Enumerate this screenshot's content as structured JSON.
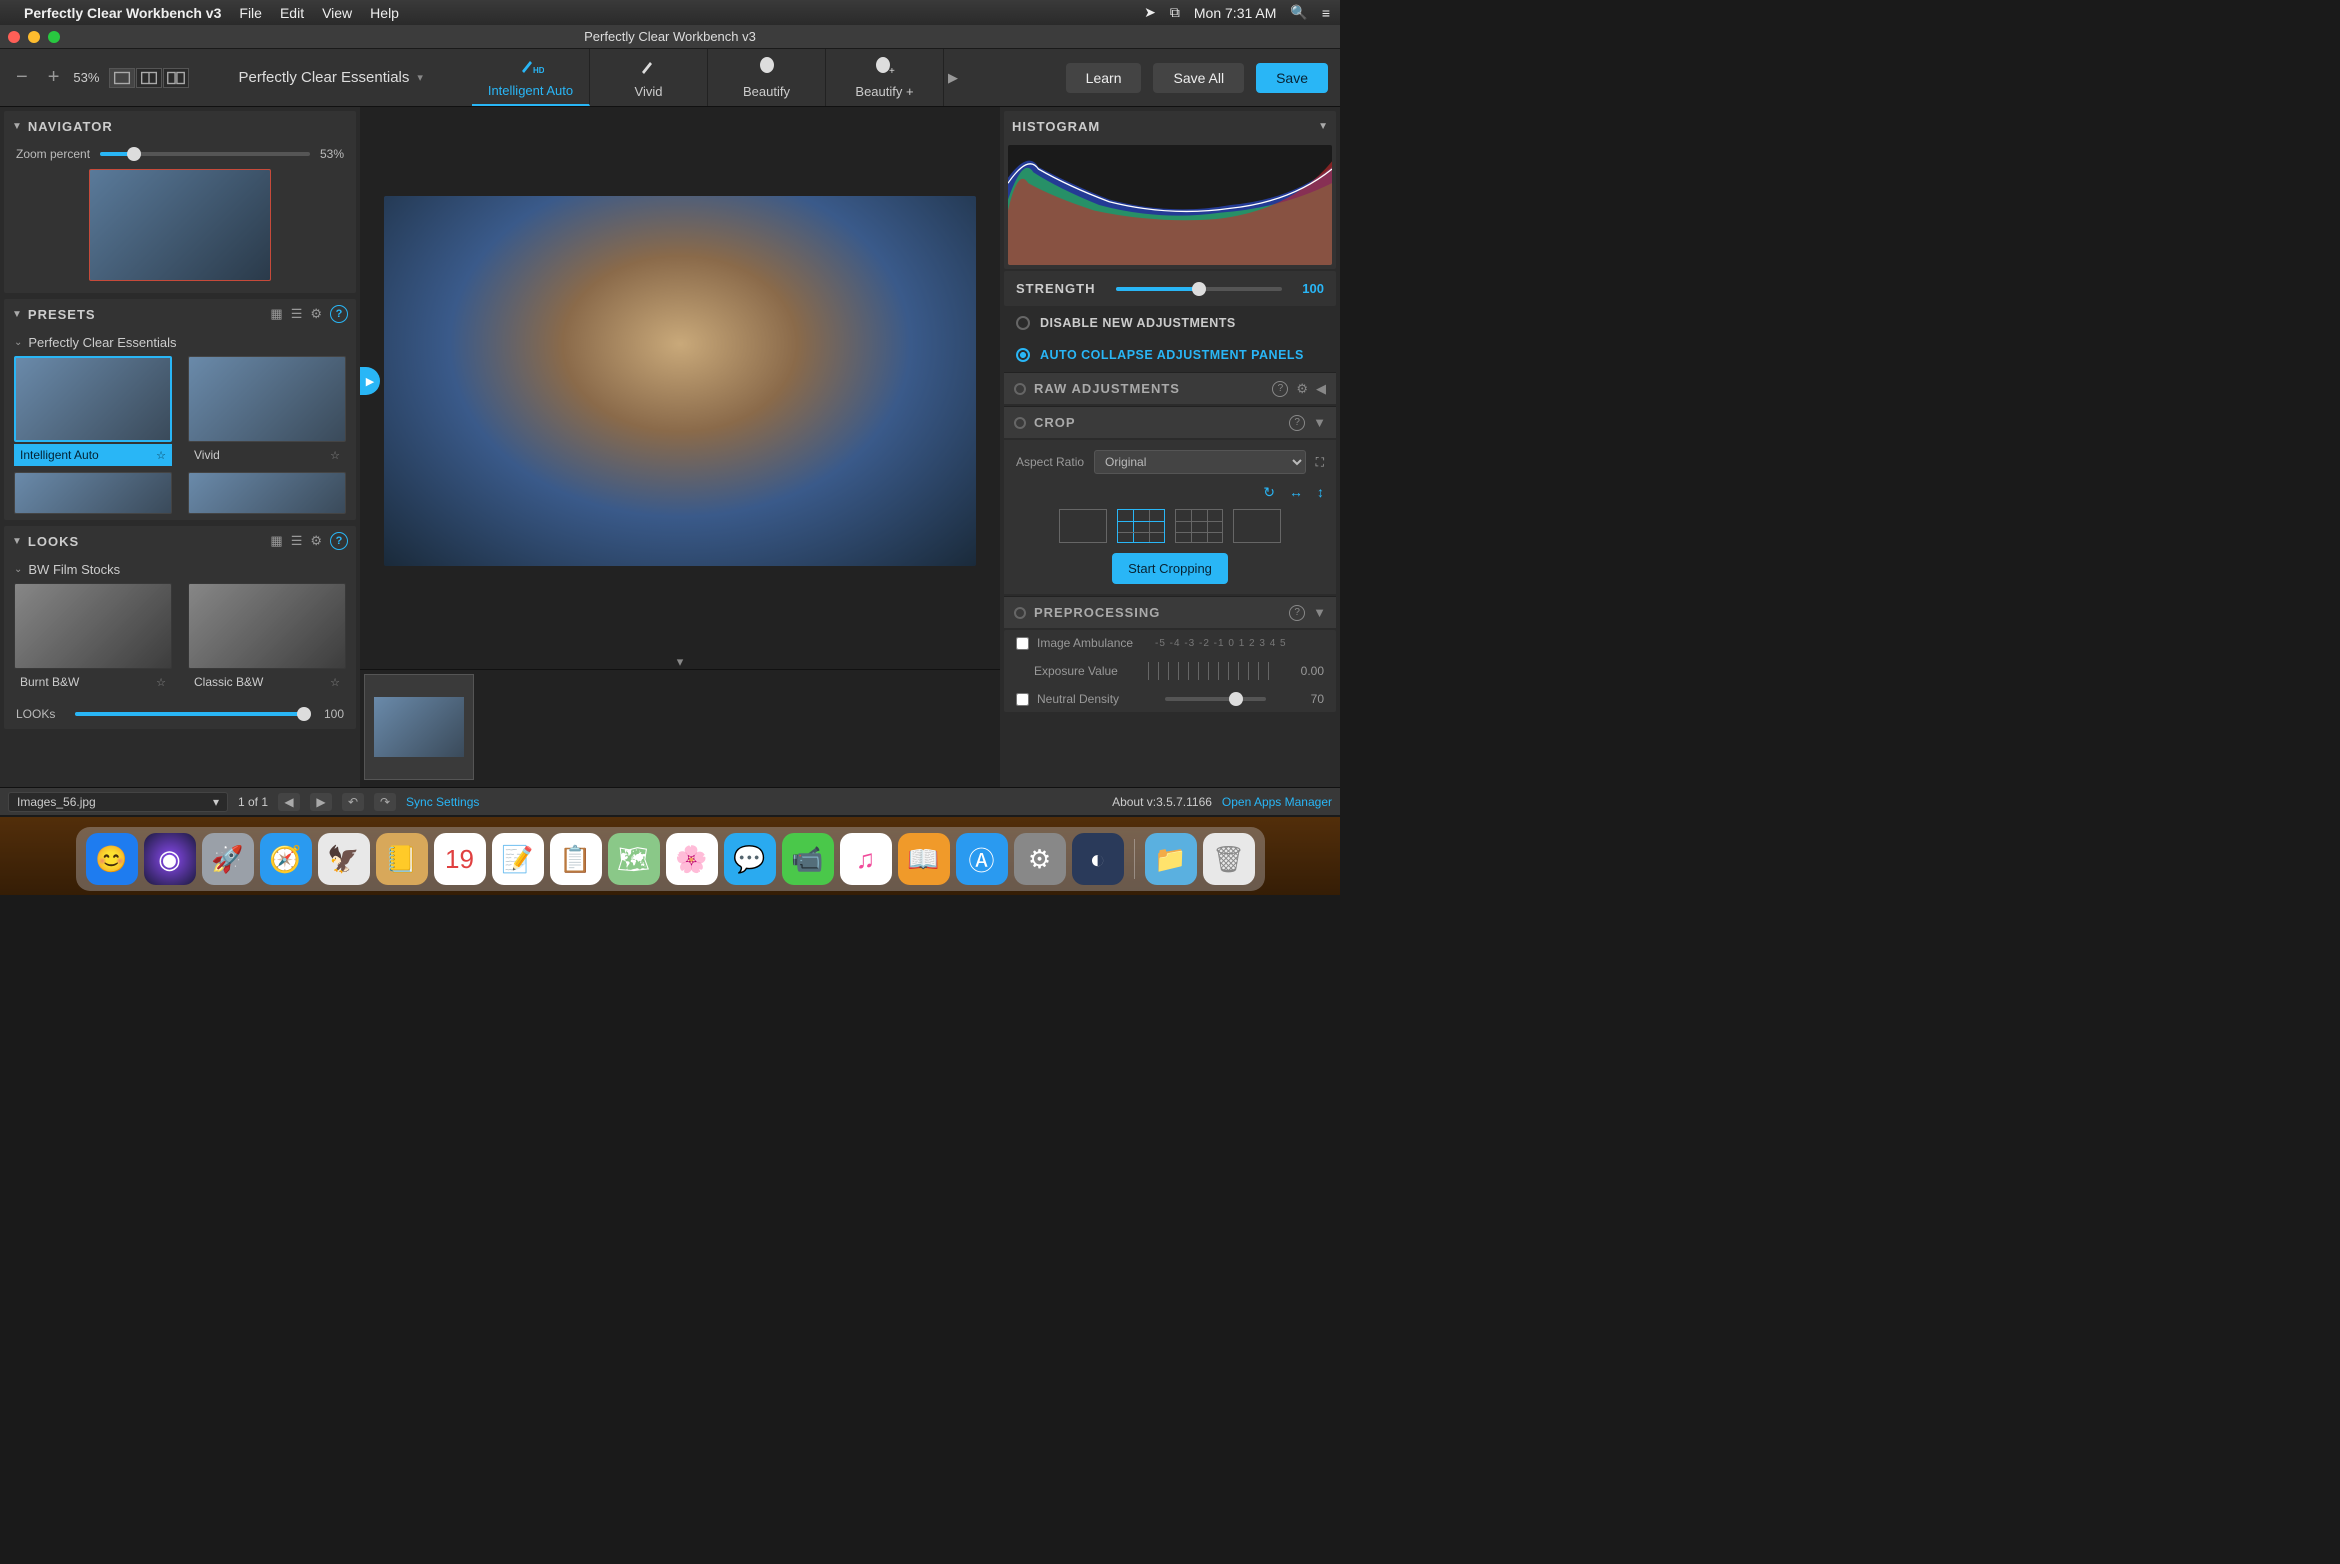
{
  "menubar": {
    "app_name": "Perfectly Clear Workbench v3",
    "items": [
      "File",
      "Edit",
      "View",
      "Help"
    ],
    "clock": "Mon 7:31 AM"
  },
  "window": {
    "title": "Perfectly Clear Workbench v3"
  },
  "toolbar": {
    "zoom_minus": "−",
    "zoom_plus": "+",
    "zoom_value": "53%",
    "preset_name": "Perfectly Clear Essentials",
    "tabs": [
      {
        "label": "Intelligent Auto",
        "badge": "HD",
        "active": true
      },
      {
        "label": "Vivid",
        "active": false
      },
      {
        "label": "Beautify",
        "active": false
      },
      {
        "label": "Beautify +",
        "active": false
      }
    ],
    "learn": "Learn",
    "save_all": "Save All",
    "save": "Save"
  },
  "navigator": {
    "title": "NAVIGATOR",
    "zoom_label": "Zoom percent",
    "zoom_value": "53%",
    "zoom_pct": 16
  },
  "presets": {
    "title": "PRESETS",
    "group": "Perfectly Clear Essentials",
    "items": [
      {
        "label": "Intelligent Auto",
        "selected": true
      },
      {
        "label": "Vivid",
        "selected": false
      }
    ]
  },
  "looks": {
    "title": "LOOKS",
    "group": "BW Film Stocks",
    "items": [
      {
        "label": "Burnt B&W"
      },
      {
        "label": "Classic B&W"
      }
    ],
    "slider_label": "LOOKs",
    "slider_value": "100"
  },
  "histogram": {
    "title": "HISTOGRAM"
  },
  "strength": {
    "label": "STRENGTH",
    "value": "100",
    "pct": 50
  },
  "toggles": {
    "disable": "DISABLE NEW ADJUSTMENTS",
    "collapse": "AUTO COLLAPSE ADJUSTMENT PANELS"
  },
  "sections": {
    "raw": "RAW ADJUSTMENTS",
    "crop": {
      "title": "CROP",
      "aspect_label": "Aspect Ratio",
      "aspect_value": "Original",
      "start": "Start Cropping"
    },
    "pre": {
      "title": "PREPROCESSING",
      "ambulance_label": "Image Ambulance",
      "exposure_label": "Exposure Value",
      "exposure_scale": "-5 -4 -3 -2 -1 0 1 2 3 4 5",
      "exposure_value": "0.00",
      "nd_label": "Neutral Density",
      "nd_value": "70"
    }
  },
  "bottom": {
    "filename": "Images_56.jpg",
    "counter": "1 of 1",
    "sync": "Sync Settings",
    "about": "About v:3.5.7.1166",
    "manager": "Open Apps Manager"
  }
}
